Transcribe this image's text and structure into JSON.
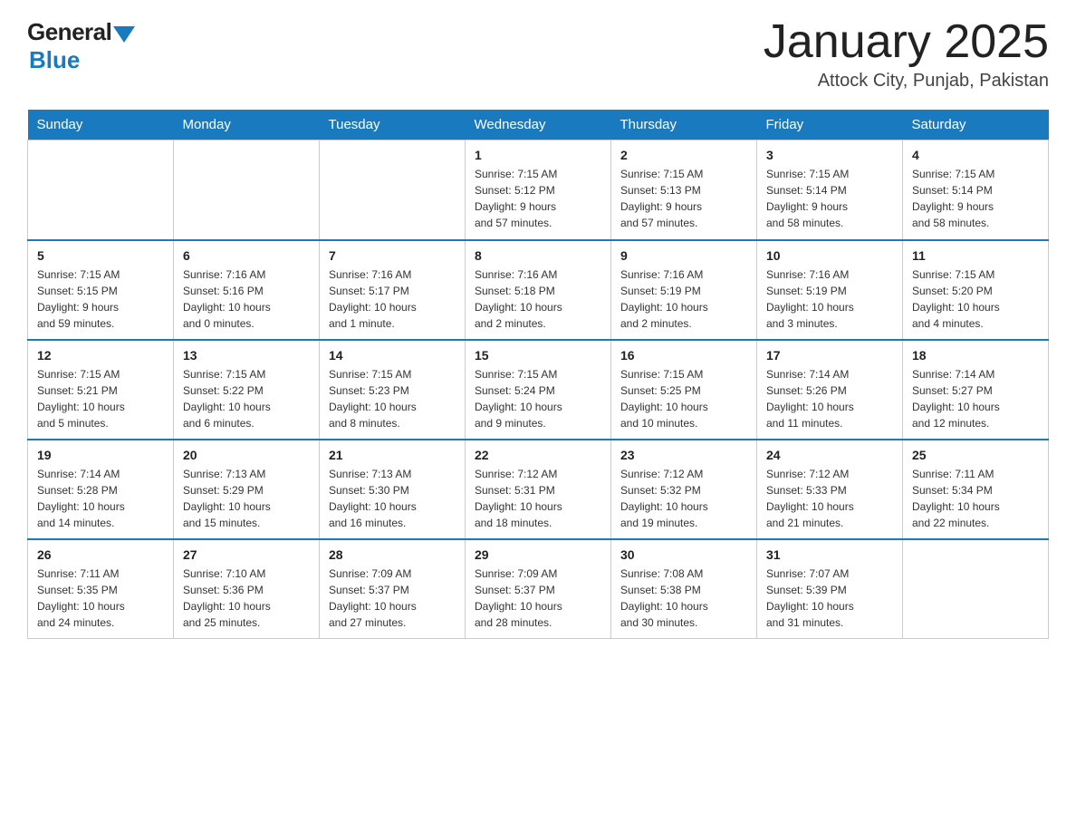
{
  "header": {
    "logo_general": "General",
    "logo_blue": "Blue",
    "title": "January 2025",
    "location": "Attock City, Punjab, Pakistan"
  },
  "days_of_week": [
    "Sunday",
    "Monday",
    "Tuesday",
    "Wednesday",
    "Thursday",
    "Friday",
    "Saturday"
  ],
  "weeks": [
    [
      {
        "day": "",
        "info": ""
      },
      {
        "day": "",
        "info": ""
      },
      {
        "day": "",
        "info": ""
      },
      {
        "day": "1",
        "info": "Sunrise: 7:15 AM\nSunset: 5:12 PM\nDaylight: 9 hours\nand 57 minutes."
      },
      {
        "day": "2",
        "info": "Sunrise: 7:15 AM\nSunset: 5:13 PM\nDaylight: 9 hours\nand 57 minutes."
      },
      {
        "day": "3",
        "info": "Sunrise: 7:15 AM\nSunset: 5:14 PM\nDaylight: 9 hours\nand 58 minutes."
      },
      {
        "day": "4",
        "info": "Sunrise: 7:15 AM\nSunset: 5:14 PM\nDaylight: 9 hours\nand 58 minutes."
      }
    ],
    [
      {
        "day": "5",
        "info": "Sunrise: 7:15 AM\nSunset: 5:15 PM\nDaylight: 9 hours\nand 59 minutes."
      },
      {
        "day": "6",
        "info": "Sunrise: 7:16 AM\nSunset: 5:16 PM\nDaylight: 10 hours\nand 0 minutes."
      },
      {
        "day": "7",
        "info": "Sunrise: 7:16 AM\nSunset: 5:17 PM\nDaylight: 10 hours\nand 1 minute."
      },
      {
        "day": "8",
        "info": "Sunrise: 7:16 AM\nSunset: 5:18 PM\nDaylight: 10 hours\nand 2 minutes."
      },
      {
        "day": "9",
        "info": "Sunrise: 7:16 AM\nSunset: 5:19 PM\nDaylight: 10 hours\nand 2 minutes."
      },
      {
        "day": "10",
        "info": "Sunrise: 7:16 AM\nSunset: 5:19 PM\nDaylight: 10 hours\nand 3 minutes."
      },
      {
        "day": "11",
        "info": "Sunrise: 7:15 AM\nSunset: 5:20 PM\nDaylight: 10 hours\nand 4 minutes."
      }
    ],
    [
      {
        "day": "12",
        "info": "Sunrise: 7:15 AM\nSunset: 5:21 PM\nDaylight: 10 hours\nand 5 minutes."
      },
      {
        "day": "13",
        "info": "Sunrise: 7:15 AM\nSunset: 5:22 PM\nDaylight: 10 hours\nand 6 minutes."
      },
      {
        "day": "14",
        "info": "Sunrise: 7:15 AM\nSunset: 5:23 PM\nDaylight: 10 hours\nand 8 minutes."
      },
      {
        "day": "15",
        "info": "Sunrise: 7:15 AM\nSunset: 5:24 PM\nDaylight: 10 hours\nand 9 minutes."
      },
      {
        "day": "16",
        "info": "Sunrise: 7:15 AM\nSunset: 5:25 PM\nDaylight: 10 hours\nand 10 minutes."
      },
      {
        "day": "17",
        "info": "Sunrise: 7:14 AM\nSunset: 5:26 PM\nDaylight: 10 hours\nand 11 minutes."
      },
      {
        "day": "18",
        "info": "Sunrise: 7:14 AM\nSunset: 5:27 PM\nDaylight: 10 hours\nand 12 minutes."
      }
    ],
    [
      {
        "day": "19",
        "info": "Sunrise: 7:14 AM\nSunset: 5:28 PM\nDaylight: 10 hours\nand 14 minutes."
      },
      {
        "day": "20",
        "info": "Sunrise: 7:13 AM\nSunset: 5:29 PM\nDaylight: 10 hours\nand 15 minutes."
      },
      {
        "day": "21",
        "info": "Sunrise: 7:13 AM\nSunset: 5:30 PM\nDaylight: 10 hours\nand 16 minutes."
      },
      {
        "day": "22",
        "info": "Sunrise: 7:12 AM\nSunset: 5:31 PM\nDaylight: 10 hours\nand 18 minutes."
      },
      {
        "day": "23",
        "info": "Sunrise: 7:12 AM\nSunset: 5:32 PM\nDaylight: 10 hours\nand 19 minutes."
      },
      {
        "day": "24",
        "info": "Sunrise: 7:12 AM\nSunset: 5:33 PM\nDaylight: 10 hours\nand 21 minutes."
      },
      {
        "day": "25",
        "info": "Sunrise: 7:11 AM\nSunset: 5:34 PM\nDaylight: 10 hours\nand 22 minutes."
      }
    ],
    [
      {
        "day": "26",
        "info": "Sunrise: 7:11 AM\nSunset: 5:35 PM\nDaylight: 10 hours\nand 24 minutes."
      },
      {
        "day": "27",
        "info": "Sunrise: 7:10 AM\nSunset: 5:36 PM\nDaylight: 10 hours\nand 25 minutes."
      },
      {
        "day": "28",
        "info": "Sunrise: 7:09 AM\nSunset: 5:37 PM\nDaylight: 10 hours\nand 27 minutes."
      },
      {
        "day": "29",
        "info": "Sunrise: 7:09 AM\nSunset: 5:37 PM\nDaylight: 10 hours\nand 28 minutes."
      },
      {
        "day": "30",
        "info": "Sunrise: 7:08 AM\nSunset: 5:38 PM\nDaylight: 10 hours\nand 30 minutes."
      },
      {
        "day": "31",
        "info": "Sunrise: 7:07 AM\nSunset: 5:39 PM\nDaylight: 10 hours\nand 31 minutes."
      },
      {
        "day": "",
        "info": ""
      }
    ]
  ]
}
